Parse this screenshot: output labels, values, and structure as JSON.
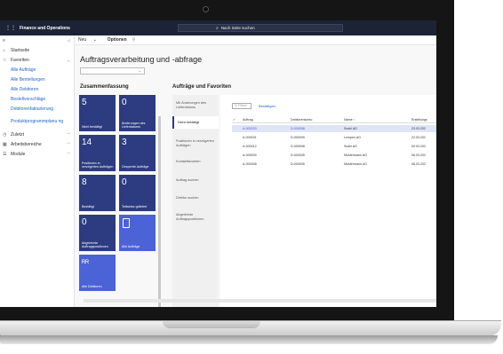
{
  "app": {
    "name": "Finance and Operations",
    "search_placeholder": "Nach Seite suchen"
  },
  "sidebar": {
    "home": "Startseite",
    "favorites": "Favoriten",
    "favorite_items": [
      "Alle Aufträge",
      "Alle Bestellungen",
      "Alle Debitoren",
      "Bestellvorschläge",
      "Debitorenfakturierung",
      "Produktprogrammplanu ng"
    ],
    "recent": "Zuletzt",
    "workspaces": "Arbeitsbereiche",
    "modules": "Module"
  },
  "commandbar": {
    "new": "Neu",
    "options": "Optionen"
  },
  "page": {
    "title": "Auftragsverarbeitung und -abfrage",
    "summary_title": "Zusammenfassung",
    "favorites_title": "Aufträge und Favoriten"
  },
  "tiles": [
    {
      "num": "5",
      "label": "Nicht bestätigt",
      "style": "dark"
    },
    {
      "num": "0",
      "label": "Änderungen des Lieferdatums",
      "style": "dark"
    },
    {
      "num": "14",
      "label": "Positionen in verzögerten Aufträgen",
      "style": "dark"
    },
    {
      "num": "3",
      "label": "Gesperrte Aufträge",
      "style": "dark"
    },
    {
      "num": "8",
      "label": "Bestätigt",
      "style": "dark"
    },
    {
      "num": "0",
      "label": "Teilweise geliefert",
      "style": "dark"
    },
    {
      "num": "0",
      "label": "Abgelehnte Auftragspositionen",
      "style": "dark"
    },
    {
      "num": "",
      "label": "Alle Aufträge",
      "style": "light",
      "icon": "document-icon"
    },
    {
      "num": "",
      "label": "Alle Debitoren",
      "style": "light",
      "icon": "people-icon"
    }
  ],
  "fav_list": [
    "Mit Änderungen des Lieferdatums",
    "Nicht bestätigt",
    "Positionen in verzögerten Aufträgen",
    "Kontaktfavoriten",
    "Auftrag suchen",
    "Debitor suchen",
    "Abgelehnte Auftragspositionen"
  ],
  "grid": {
    "filter_placeholder": "Filtern",
    "confirm_label": "Bestätigen",
    "columns": [
      "Auftrag",
      "Debitorenkonto",
      "Name ↑",
      "Erstellungs"
    ],
    "rows": [
      [
        "A-000033",
        "D-000008",
        "Sushi AG",
        "23.03.202"
      ],
      [
        "A-000031",
        "D-000009",
        "Lempen AG",
        "22.03.202"
      ],
      [
        "A-000012",
        "D-000008",
        "Sushi AG",
        "09.03.202"
      ],
      [
        "A-000009",
        "D-000005",
        "Mustermann AG",
        "06.03.202"
      ],
      [
        "A-000008",
        "D-000005",
        "Mustermann AG",
        "06.03.202"
      ]
    ]
  }
}
